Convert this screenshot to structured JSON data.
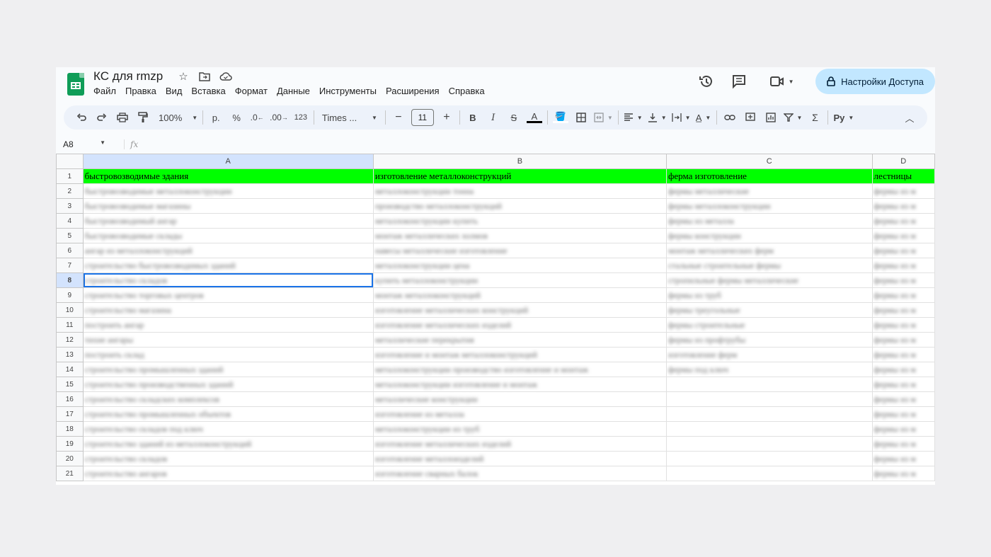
{
  "doc": {
    "title": "КС для rmzp"
  },
  "menu": [
    "Файл",
    "Правка",
    "Вид",
    "Вставка",
    "Формат",
    "Данные",
    "Инструменты",
    "Расширения",
    "Справка"
  ],
  "share": {
    "label": "Настройки Доступа"
  },
  "toolbar": {
    "zoom": "100%",
    "currency": "р.",
    "percent": "%",
    "dec_minus": ".0",
    "dec_plus": ".00",
    "number_format": "123",
    "font": "Times ...",
    "font_size": "11",
    "mode": "Ру"
  },
  "formula_bar": {
    "cell_ref": "A8",
    "fx": "fx"
  },
  "columns": [
    "A",
    "B",
    "C",
    "D"
  ],
  "rows": [
    {
      "n": "1",
      "a": "быстровозводимые здания",
      "b": "изготовление металлоконструкций",
      "c": "ферма изготовление",
      "d": "лестницы"
    },
    {
      "n": "2",
      "a": "быстровозводимые металлоконструкции",
      "b": "металлоконструкции тонна",
      "c": "фермы металлические",
      "d": "фермы из м"
    },
    {
      "n": "3",
      "a": "быстровозводимые магазины",
      "b": "производство металлоконструкций",
      "c": "фермы металлоконструкции",
      "d": "фермы из м"
    },
    {
      "n": "4",
      "a": "быстровозводимый ангар",
      "b": "металлоконструкции купить",
      "c": "фермы из металла",
      "d": "фермы из м"
    },
    {
      "n": "5",
      "a": "быстровозводимые склады",
      "b": "монтаж металлических холмов",
      "c": "фермы конструкции",
      "d": "фермы из м"
    },
    {
      "n": "6",
      "a": "ангар из металлоконструкций",
      "b": "навесы металлические изготовление",
      "c": "монтаж металлических ферм",
      "d": "фермы из м"
    },
    {
      "n": "7",
      "a": "строительство быстровозводимых зданий",
      "b": "металлоконструкции цена",
      "c": "стальные строительные фермы",
      "d": "фермы из м"
    },
    {
      "n": "8",
      "a": "строительство складов",
      "b": "купить металлоконструкции",
      "c": "стропильные фермы металлические",
      "d": "фермы из м"
    },
    {
      "n": "9",
      "a": "строительство торговых центров",
      "b": "монтаж металлоконструкций",
      "c": "фермы из труб",
      "d": "фермы из м"
    },
    {
      "n": "10",
      "a": "строительство магазина",
      "b": "изготовление металлических конструкций",
      "c": "фермы треугольные",
      "d": "фермы из м"
    },
    {
      "n": "11",
      "a": "построить ангар",
      "b": "изготовление металлических изделий",
      "c": "фермы строительные",
      "d": "фермы из м"
    },
    {
      "n": "12",
      "a": "тихие ангары",
      "b": "металлические перекрытия",
      "c": "фермы из профтрубы",
      "d": "фермы из м"
    },
    {
      "n": "13",
      "a": "построить склад",
      "b": "изготовление и монтаж металлоконструкций",
      "c": "изготовление ферм",
      "d": "фермы из м"
    },
    {
      "n": "14",
      "a": "строительство промышленных зданий",
      "b": "металлоконструкции производство изготовление и монтаж",
      "c": "фермы под ключ",
      "d": "фермы из м"
    },
    {
      "n": "15",
      "a": "строительство производственных зданий",
      "b": "металлоконструкции изготовление и монтаж",
      "c": "",
      "d": "фермы из м"
    },
    {
      "n": "16",
      "a": "строительство складских комплексов",
      "b": "металлические конструкции",
      "c": "",
      "d": "фермы из м"
    },
    {
      "n": "17",
      "a": "строительство промышленных объектов",
      "b": "изготовление из металла",
      "c": "",
      "d": "фермы из м"
    },
    {
      "n": "18",
      "a": "строительство складов под ключ",
      "b": "металлоконструкции из труб",
      "c": "",
      "d": "фермы из м"
    },
    {
      "n": "19",
      "a": "строительство зданий из металлоконструкций",
      "b": "изготовление металлических изделий",
      "c": "",
      "d": "фермы из м"
    },
    {
      "n": "20",
      "a": "строительство складов",
      "b": "изготовление металлоизделий",
      "c": "",
      "d": "фермы из м"
    },
    {
      "n": "21",
      "a": "строительство ангаров",
      "b": "изготовление сварных балок",
      "c": "",
      "d": "фермы из м"
    }
  ]
}
